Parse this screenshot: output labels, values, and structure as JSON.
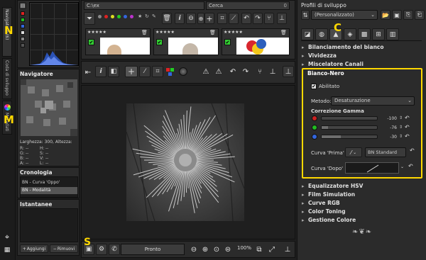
{
  "left_strip": {
    "tab_navigator": "Navigatore (6)",
    "tab_dev_queue": "Coda di sviluppo",
    "tab_metadata": "Metadati"
  },
  "navigator": {
    "title": "Navigatore",
    "size_label": "Larghezza: 300, Altezza:",
    "r": "R:",
    "g": "G:",
    "b": "B:",
    "a": "A:",
    "r_val": "--",
    "g_val": "--",
    "b_val": "--",
    "a_val": "--",
    "h": "H:",
    "s": "S:",
    "v": "V:",
    "l": "L:",
    "h_val": "--",
    "s_val": "--",
    "v_val": "--",
    "l_val": "--"
  },
  "history": {
    "title": "Cronologia",
    "items": [
      "BN - Curva 'Oppo'",
      "BN - Modalità"
    ]
  },
  "snapshots": {
    "title": "Istantanee",
    "add": "Aggiungi",
    "remove": "Rimuovi"
  },
  "filebrowser": {
    "path": "C:\\ex",
    "search_placeholder": "Cerca",
    "search_count": "0",
    "rank": "★★★★★"
  },
  "footer": {
    "status": "Pronto",
    "zoom": "100%"
  },
  "profiles": {
    "title": "Profili di sviluppo",
    "selected": "(Personalizzato)"
  },
  "tools": {
    "white_balance": "Bilanciamento del bianco",
    "vibrance": "Vividezza",
    "channel_mixer": "Miscelatore Canali",
    "bw_title": "Bianco-Nero",
    "enabled": "Abilitato",
    "method_label": "Metodo:",
    "method_value": "Desaturazione",
    "gamma_title": "Correzione Gamma",
    "gamma_red": "-100",
    "gamma_green": "-76",
    "gamma_blue": "-30",
    "curve_before_label": "Curva 'Prima'",
    "curve_before_value": "BN Standard",
    "curve_after_label": "Curva 'Dopo'",
    "hsv_eq": "Equalizzatore HSV",
    "film_sim": "Film Simulation",
    "rgb_curves": "Curve RGB",
    "color_toning": "Color Toning",
    "color_mgmt": "Gestione Colore"
  },
  "annotations": {
    "N": "N",
    "M": "M",
    "C": "C",
    "S": "S"
  },
  "colors": {
    "highlight_yellow": "#ffd800",
    "panel_bg": "#2b2b2b",
    "dark_bg": "#1e1e1e"
  }
}
